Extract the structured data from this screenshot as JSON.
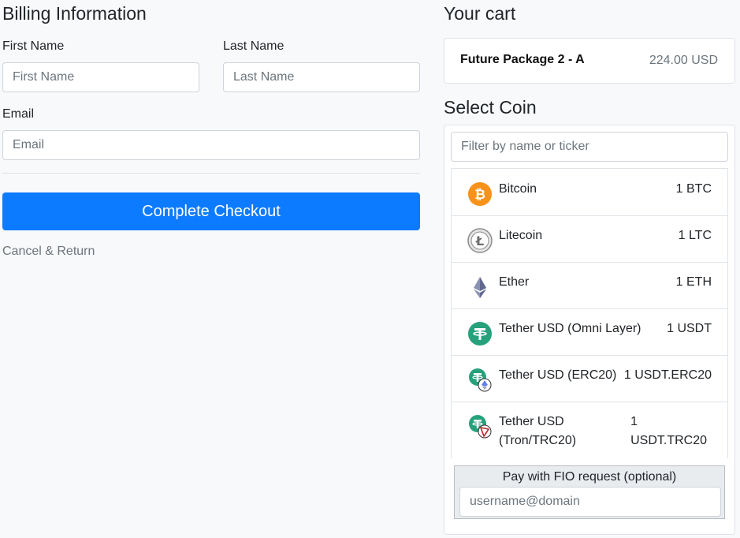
{
  "billing": {
    "title": "Billing Information",
    "first_name_label": "First Name",
    "first_name_placeholder": "First Name",
    "last_name_label": "Last Name",
    "last_name_placeholder": "Last Name",
    "email_label": "Email",
    "email_placeholder": "Email",
    "checkout_label": "Complete Checkout",
    "cancel_label": "Cancel & Return"
  },
  "cart": {
    "title": "Your cart",
    "item_name": "Future Package 2 - A",
    "item_price": "224.00 USD"
  },
  "coins": {
    "title": "Select Coin",
    "filter_placeholder": "Filter by name or ticker",
    "items": [
      {
        "name": "Bitcoin",
        "amount": "1 BTC",
        "icon": "bitcoin-icon"
      },
      {
        "name": "Litecoin",
        "amount": "1 LTC",
        "icon": "litecoin-icon"
      },
      {
        "name": "Ether",
        "amount": "1 ETH",
        "icon": "ether-icon"
      },
      {
        "name": "Tether USD (Omni Layer)",
        "amount": "1 USDT",
        "icon": "tether-icon"
      },
      {
        "name": "Tether USD (ERC20)",
        "amount": "1 USDT.ERC20",
        "icon": "tether-erc20-icon"
      },
      {
        "name_line1": "Tether USD",
        "name_line2": "(Tron/TRC20)",
        "amount_line1": "1",
        "amount_line2": "USDT.TRC20",
        "icon": "tether-trc20-icon"
      }
    ]
  },
  "fio": {
    "label": "Pay with FIO request (optional)",
    "placeholder": "username@domain"
  },
  "colors": {
    "primary": "#0d7bff",
    "bitcoin": "#f7931a",
    "tether": "#26a17b",
    "tron": "#c4232b",
    "ether": "#627eea",
    "litecoin": "#8c8c8c"
  }
}
